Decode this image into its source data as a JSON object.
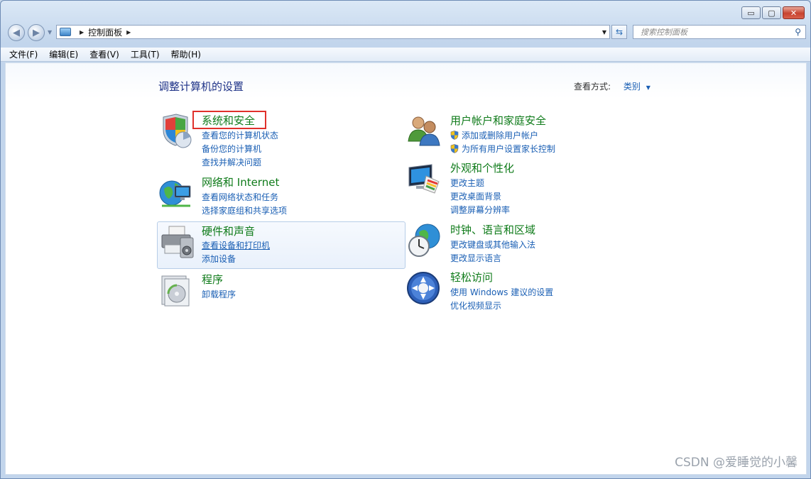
{
  "window": {
    "caption_buttons": {
      "minimize": "▭",
      "maximize": "▢",
      "close": "✕"
    }
  },
  "address_bar": {
    "crumbs": [
      "控制面板"
    ]
  },
  "search": {
    "placeholder": "搜索控制面板"
  },
  "menu": [
    "文件(F)",
    "编辑(E)",
    "查看(V)",
    "工具(T)",
    "帮助(H)"
  ],
  "page": {
    "title": "调整计算机的设置",
    "view_label": "查看方式:",
    "view_value": "类别"
  },
  "categories": [
    {
      "title": "系统和安全",
      "links": [
        "查看您的计算机状态",
        "备份您的计算机",
        "查找并解决问题"
      ],
      "icon": "shield-icon"
    },
    {
      "title": "网络和 Internet",
      "links": [
        "查看网络状态和任务",
        "选择家庭组和共享选项"
      ],
      "icon": "network-globe-icon"
    },
    {
      "title": "硬件和声音",
      "links": [
        "查看设备和打印机",
        "添加设备"
      ],
      "icon": "printer-icon"
    },
    {
      "title": "程序",
      "links": [
        "卸载程序"
      ],
      "icon": "programs-icon"
    },
    {
      "title": "用户帐户和家庭安全",
      "links": [
        "添加或删除用户帐户",
        "为所有用户设置家长控制"
      ],
      "icon": "users-icon"
    },
    {
      "title": "外观和个性化",
      "links": [
        "更改主题",
        "更改桌面背景",
        "调整屏幕分辨率"
      ],
      "icon": "monitor-palette-icon"
    },
    {
      "title": "时钟、语言和区域",
      "links": [
        "更改键盘或其他输入法",
        "更改显示语言"
      ],
      "icon": "clock-globe-icon"
    },
    {
      "title": "轻松访问",
      "links": [
        "使用 Windows 建议的设置",
        "优化视频显示"
      ],
      "icon": "ease-of-access-icon"
    }
  ],
  "watermark": "CSDN @爱睡觉的小馨"
}
